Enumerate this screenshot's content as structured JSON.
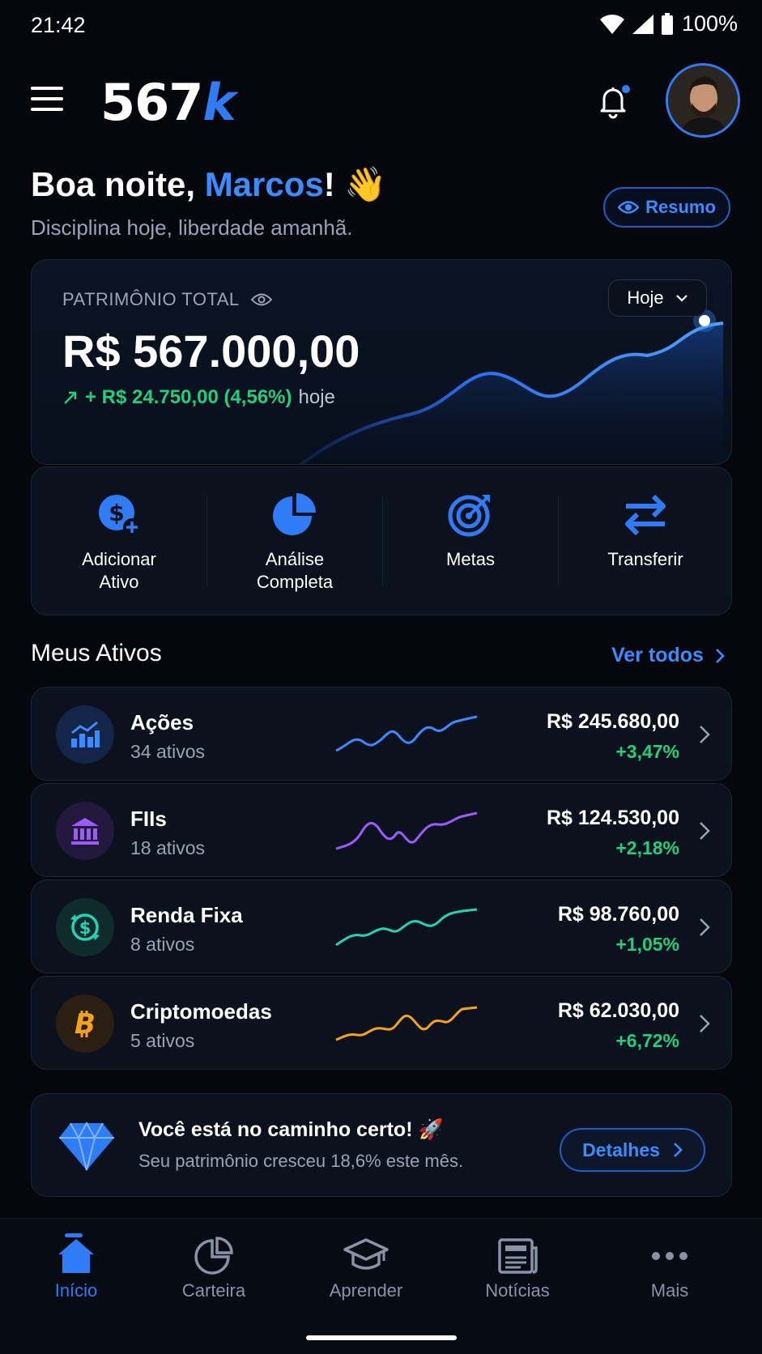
{
  "status_bar": {
    "time": "21:42",
    "battery": "100%"
  },
  "header": {
    "logo_text": "567",
    "logo_mark": "k"
  },
  "greeting": {
    "prefix": "Boa noite, ",
    "name": "Marcos",
    "suffix": "!",
    "emoji": "👋",
    "subtitle": "Disciplina hoje, liberdade amanhã."
  },
  "resumo_button": {
    "label": "Resumo",
    "icon": "eye-icon"
  },
  "patrimonio": {
    "label": "PATRIMÔNIO TOTAL",
    "value": "R$ 567.000,00",
    "change": "+ R$ 24.750,00 (4,56%)",
    "change_suffix": "hoje",
    "period": "Hoje"
  },
  "actions": [
    {
      "label": "Adicionar\nAtivo",
      "icon": "add-asset-icon"
    },
    {
      "label": "Análise\nCompleta",
      "icon": "pie-chart-icon"
    },
    {
      "label": "Metas",
      "icon": "target-icon"
    },
    {
      "label": "Transferir",
      "icon": "transfer-icon"
    }
  ],
  "assets_section": {
    "title": "Meus Ativos",
    "see_all": "Ver todos"
  },
  "assets": [
    {
      "name": "Ações",
      "count": "34 ativos",
      "value": "R$ 245.680,00",
      "change": "+3,47%",
      "color": "#3c8bff",
      "icon": "bar-chart-icon"
    },
    {
      "name": "FIIs",
      "count": "18 ativos",
      "value": "R$ 124.530,00",
      "change": "+2,18%",
      "color": "#9b5cff",
      "icon": "bank-icon"
    },
    {
      "name": "Renda Fixa",
      "count": "8 ativos",
      "value": "R$ 98.760,00",
      "change": "+1,05%",
      "color": "#22d3b4",
      "icon": "dollar-cycle-icon"
    },
    {
      "name": "Criptomoedas",
      "count": "5 ativos",
      "value": "R$ 62.030,00",
      "change": "+6,72%",
      "color": "#f7a21b",
      "icon": "bitcoin-icon"
    }
  ],
  "promo": {
    "title": "Você está no caminho certo! 🚀",
    "subtitle": "Seu patrimônio cresceu 18,6% este mês.",
    "button": "Detalhes",
    "icon": "diamond-icon"
  },
  "bottom_nav": [
    {
      "label": "Início",
      "icon": "home-icon",
      "active": true
    },
    {
      "label": "Carteira",
      "icon": "pie-chart-icon",
      "active": false
    },
    {
      "label": "Aprender",
      "icon": "graduation-cap-icon",
      "active": false
    },
    {
      "label": "Notícias",
      "icon": "newspaper-icon",
      "active": false
    },
    {
      "label": "Mais",
      "icon": "more-icon",
      "active": false
    }
  ],
  "colors": {
    "accent": "#2f7cf6",
    "positive": "#20d07c",
    "background": "#05070d",
    "card": "#0b111d"
  }
}
